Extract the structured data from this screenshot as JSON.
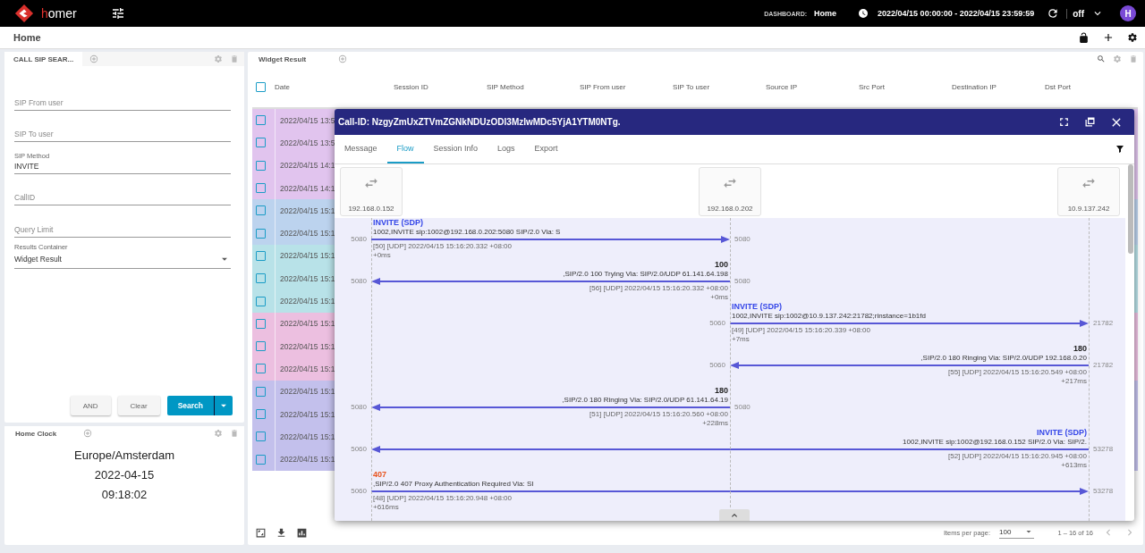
{
  "topbar": {
    "brand": "homer",
    "dashboard_label": "DASHBOARD:",
    "dashboard_name": "Home",
    "time_range": "2022/04/15 00:00:00 - 2022/04/15 23:59:59",
    "refresh": "off",
    "avatar": "H"
  },
  "page": {
    "title": "Home"
  },
  "search_widget": {
    "tab": "CALL SIP SEAR...",
    "fields": [
      {
        "kind": "text",
        "placeholder": "SIP From user"
      },
      {
        "kind": "text",
        "placeholder": "SIP To user"
      },
      {
        "kind": "text",
        "label": "SIP Method",
        "value": "INVITE"
      },
      {
        "kind": "text",
        "placeholder": "CallID"
      },
      {
        "kind": "text",
        "placeholder": "Query Limit"
      },
      {
        "kind": "select",
        "label": "Results Container",
        "value": "Widget Result"
      }
    ],
    "buttons": [
      "AND",
      "Clear",
      "Search"
    ]
  },
  "clock_widget": {
    "title": "Home Clock",
    "timezone": "Europe/Amsterdam",
    "date": "2022-04-15",
    "time": "09:18:02"
  },
  "result_widget": {
    "title": "Widget Result",
    "columns": [
      "Date",
      "Session ID",
      "SIP Method",
      "SIP From user",
      "SIP To user",
      "Source IP",
      "Src Port",
      "Destination IP",
      "Dst Port"
    ],
    "select_all_checked": false,
    "rows": [
      {
        "date": "2022/04/15 13:5",
        "color": "#e1c4ee",
        "checked": false
      },
      {
        "date": "2022/04/15 13:5",
        "color": "#e1c4ee",
        "checked": false
      },
      {
        "date": "2022/04/15 14:1",
        "color": "#e1c4ee",
        "checked": false
      },
      {
        "date": "2022/04/15 14:1",
        "color": "#e1c4ee",
        "checked": false
      },
      {
        "date": "2022/04/15 15:1",
        "color": "#bcd3ee",
        "checked": false
      },
      {
        "date": "2022/04/15 15:1",
        "color": "#bcd3ee",
        "checked": false
      },
      {
        "date": "2022/04/15 15:1",
        "color": "#b8e2e8",
        "checked": false
      },
      {
        "date": "2022/04/15 15:1",
        "color": "#b8e2e8",
        "checked": false
      },
      {
        "date": "2022/04/15 15:1",
        "color": "#b8e2e8",
        "checked": false
      },
      {
        "date": "2022/04/15 15:1",
        "color": "#ecbfe0",
        "checked": false
      },
      {
        "date": "2022/04/15 15:1",
        "color": "#ecbfe0",
        "checked": false
      },
      {
        "date": "2022/04/15 15:1",
        "color": "#ecbfe0",
        "checked": false
      },
      {
        "date": "2022/04/15 15:1",
        "color": "#c3c0ec",
        "checked": false
      },
      {
        "date": "2022/04/15 15:1",
        "color": "#c3c0ec",
        "checked": false
      },
      {
        "date": "2022/04/15 15:1",
        "color": "#c3c0ec",
        "checked": false
      },
      {
        "date": "2022/04/15 15:1",
        "color": "#c3c0ec",
        "checked": false
      }
    ],
    "paginator": {
      "label": "Items per page:",
      "page_size": "100",
      "range": "1 – 16 of 16"
    }
  },
  "dialog": {
    "title": "Call-ID: NzgyZmUxZTVmZGNkNDUzODI3MzIwMDc5YjA1YTM0NTg.",
    "tabs": [
      {
        "label": "Message",
        "selected": false
      },
      {
        "label": "Flow",
        "selected": true
      },
      {
        "label": "Session Info",
        "selected": false
      },
      {
        "label": "Logs",
        "selected": false
      },
      {
        "label": "Export",
        "selected": false
      }
    ],
    "hosts": [
      "192.168.0.152",
      "192.168.0.202",
      "10.9.137.242"
    ],
    "messages": [
      {
        "arrow": {
          "kind": "host1to2"
        },
        "kind": "request",
        "title": "INVITE (SDP)",
        "text": "1002,INVITE sip:1002@192.168.0.202:5080 SIP/2.0 Via: S",
        "meta": "[50] [UDP] 2022/04/15 15:16:20.332 +08:00",
        "delta": "+0ms",
        "left_port": "5080",
        "right_port": "5080"
      },
      {
        "arrow": {
          "kind": "host2to1"
        },
        "kind": "response",
        "title": "100",
        "text": ",SIP/2.0 100 Trying Via: SIP/2.0/UDP 61.141.64.198",
        "meta": "[56] [UDP] 2022/04/15 15:16:20.332 +08:00",
        "delta": "+0ms",
        "left_port": "5080",
        "right_port": "5080"
      },
      {
        "arrow": {
          "kind": "host2to3"
        },
        "kind": "request",
        "title": "INVITE (SDP)",
        "text": "1002,INVITE sip:1002@10.9.137.242:21782;rinstance=1b1fd",
        "meta": "[49] [UDP] 2022/04/15 15:16:20.339 +08:00",
        "delta": "+7ms",
        "left_port": "5060",
        "right_port": "21782"
      },
      {
        "arrow": {
          "kind": "host3to2"
        },
        "kind": "response",
        "title": "180",
        "text": ",SIP/2.0 180 Ringing Via: SIP/2.0/UDP 192.168.0.20",
        "meta": "[55] [UDP] 2022/04/15 15:16:20.549 +08:00",
        "delta": "+217ms",
        "left_port": "5060",
        "right_port": "21782"
      },
      {
        "arrow": {
          "kind": "host2to1"
        },
        "kind": "response",
        "title": "180",
        "text": ",SIP/2.0 180 Ringing Via: SIP/2.0/UDP 61.141.64.19",
        "meta": "[51] [UDP] 2022/04/15 15:16:20.560 +08:00",
        "delta": "+228ms",
        "left_port": "5080",
        "right_port": "5080"
      },
      {
        "arrow": {
          "kind": "host3to1"
        },
        "kind": "request",
        "title": "INVITE (SDP)",
        "text": "1002,INVITE sip:1002@192.168.0.152 SIP/2.0 Via: SIP/2.",
        "meta": "[52] [UDP] 2022/04/15 15:16:20.945 +08:00",
        "delta": "+613ms",
        "left_port": "5060",
        "right_port": "53278"
      },
      {
        "arrow": {
          "kind": "host1to3"
        },
        "kind": "error",
        "title": "407",
        "text": ",SIP/2.0 407 Proxy Authentication Required Via: SI",
        "meta": "[48] [UDP] 2022/04/15 15:16:20.948 +08:00",
        "delta": "+616ms",
        "left_port": "5060",
        "right_port": "53278"
      }
    ]
  }
}
